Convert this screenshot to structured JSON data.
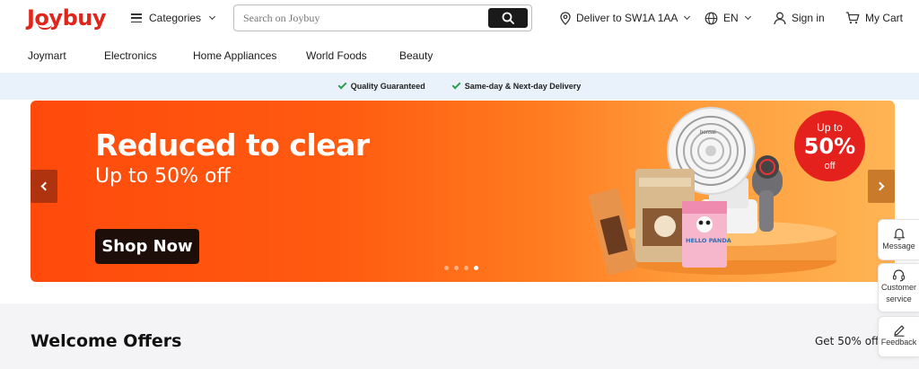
{
  "brand": {
    "logo_text": "Joybuy",
    "color": "#e1251b"
  },
  "header": {
    "categories_label": "Categories",
    "search_placeholder": "Search on Joybuy",
    "deliver_label": "Deliver to SW1A 1AA",
    "language_label": "EN",
    "signin_label": "Sign in",
    "cart_label": "My Cart"
  },
  "category_nav": {
    "items": [
      "Joymart",
      "Electronics",
      "Home Appliances",
      "World Foods",
      "Beauty"
    ]
  },
  "promise_strip": {
    "items": [
      "Quality Guaranteed",
      "Same-day & Next-day Delivery"
    ],
    "check_color": "#2e9e4c"
  },
  "banner": {
    "headline": "Reduced to clear",
    "subheadline": "Up to 50% off",
    "cta_label": "Shop Now",
    "badge": {
      "line1": "Up to",
      "line2": "50%",
      "line3": "off"
    },
    "slide_count": 4,
    "active_slide": 4,
    "product_labels": {
      "fan_brand": "bonsai",
      "snack": "HELLO PANDA"
    }
  },
  "welcome": {
    "title": "Welcome Offers",
    "side_text": "Get 50% off"
  },
  "side_toolbar": {
    "message_label": "Message",
    "customer_service_label": "Customer service",
    "feedback_label": "Feedback"
  }
}
